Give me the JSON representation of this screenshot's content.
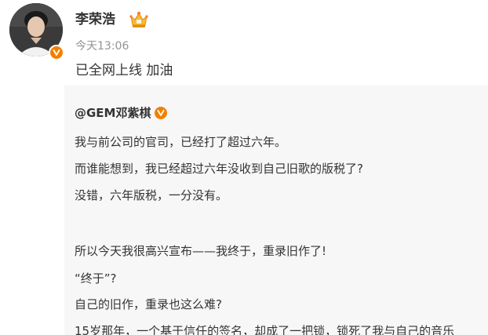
{
  "post": {
    "author_name": "李荣浩",
    "time": "今天13:06",
    "text": "已全网上线 加油"
  },
  "repost": {
    "author": "@GEM邓紫棋",
    "lines": [
      "我与前公司的官司，已经打了超过六年。",
      "而谁能想到，我已经超过六年没收到自己旧歌的版税了?",
      "没错，六年版税，一分没有。",
      "所以今天我很高兴宣布——我终于，重录旧作了!",
      "“终于”?",
      "自己的旧作，重录也这么难?",
      "15岁那年，一个基于信任的签名，却成了一把锁，锁死了我与自己的音乐"
    ]
  },
  "icons": {
    "verified": "verified-v-icon",
    "vip": "vip-crown-icon"
  },
  "colors": {
    "verified_badge": "#f28000",
    "timestamp": "#939393",
    "text": "#333333",
    "repost_background": "#f7f7f7"
  }
}
